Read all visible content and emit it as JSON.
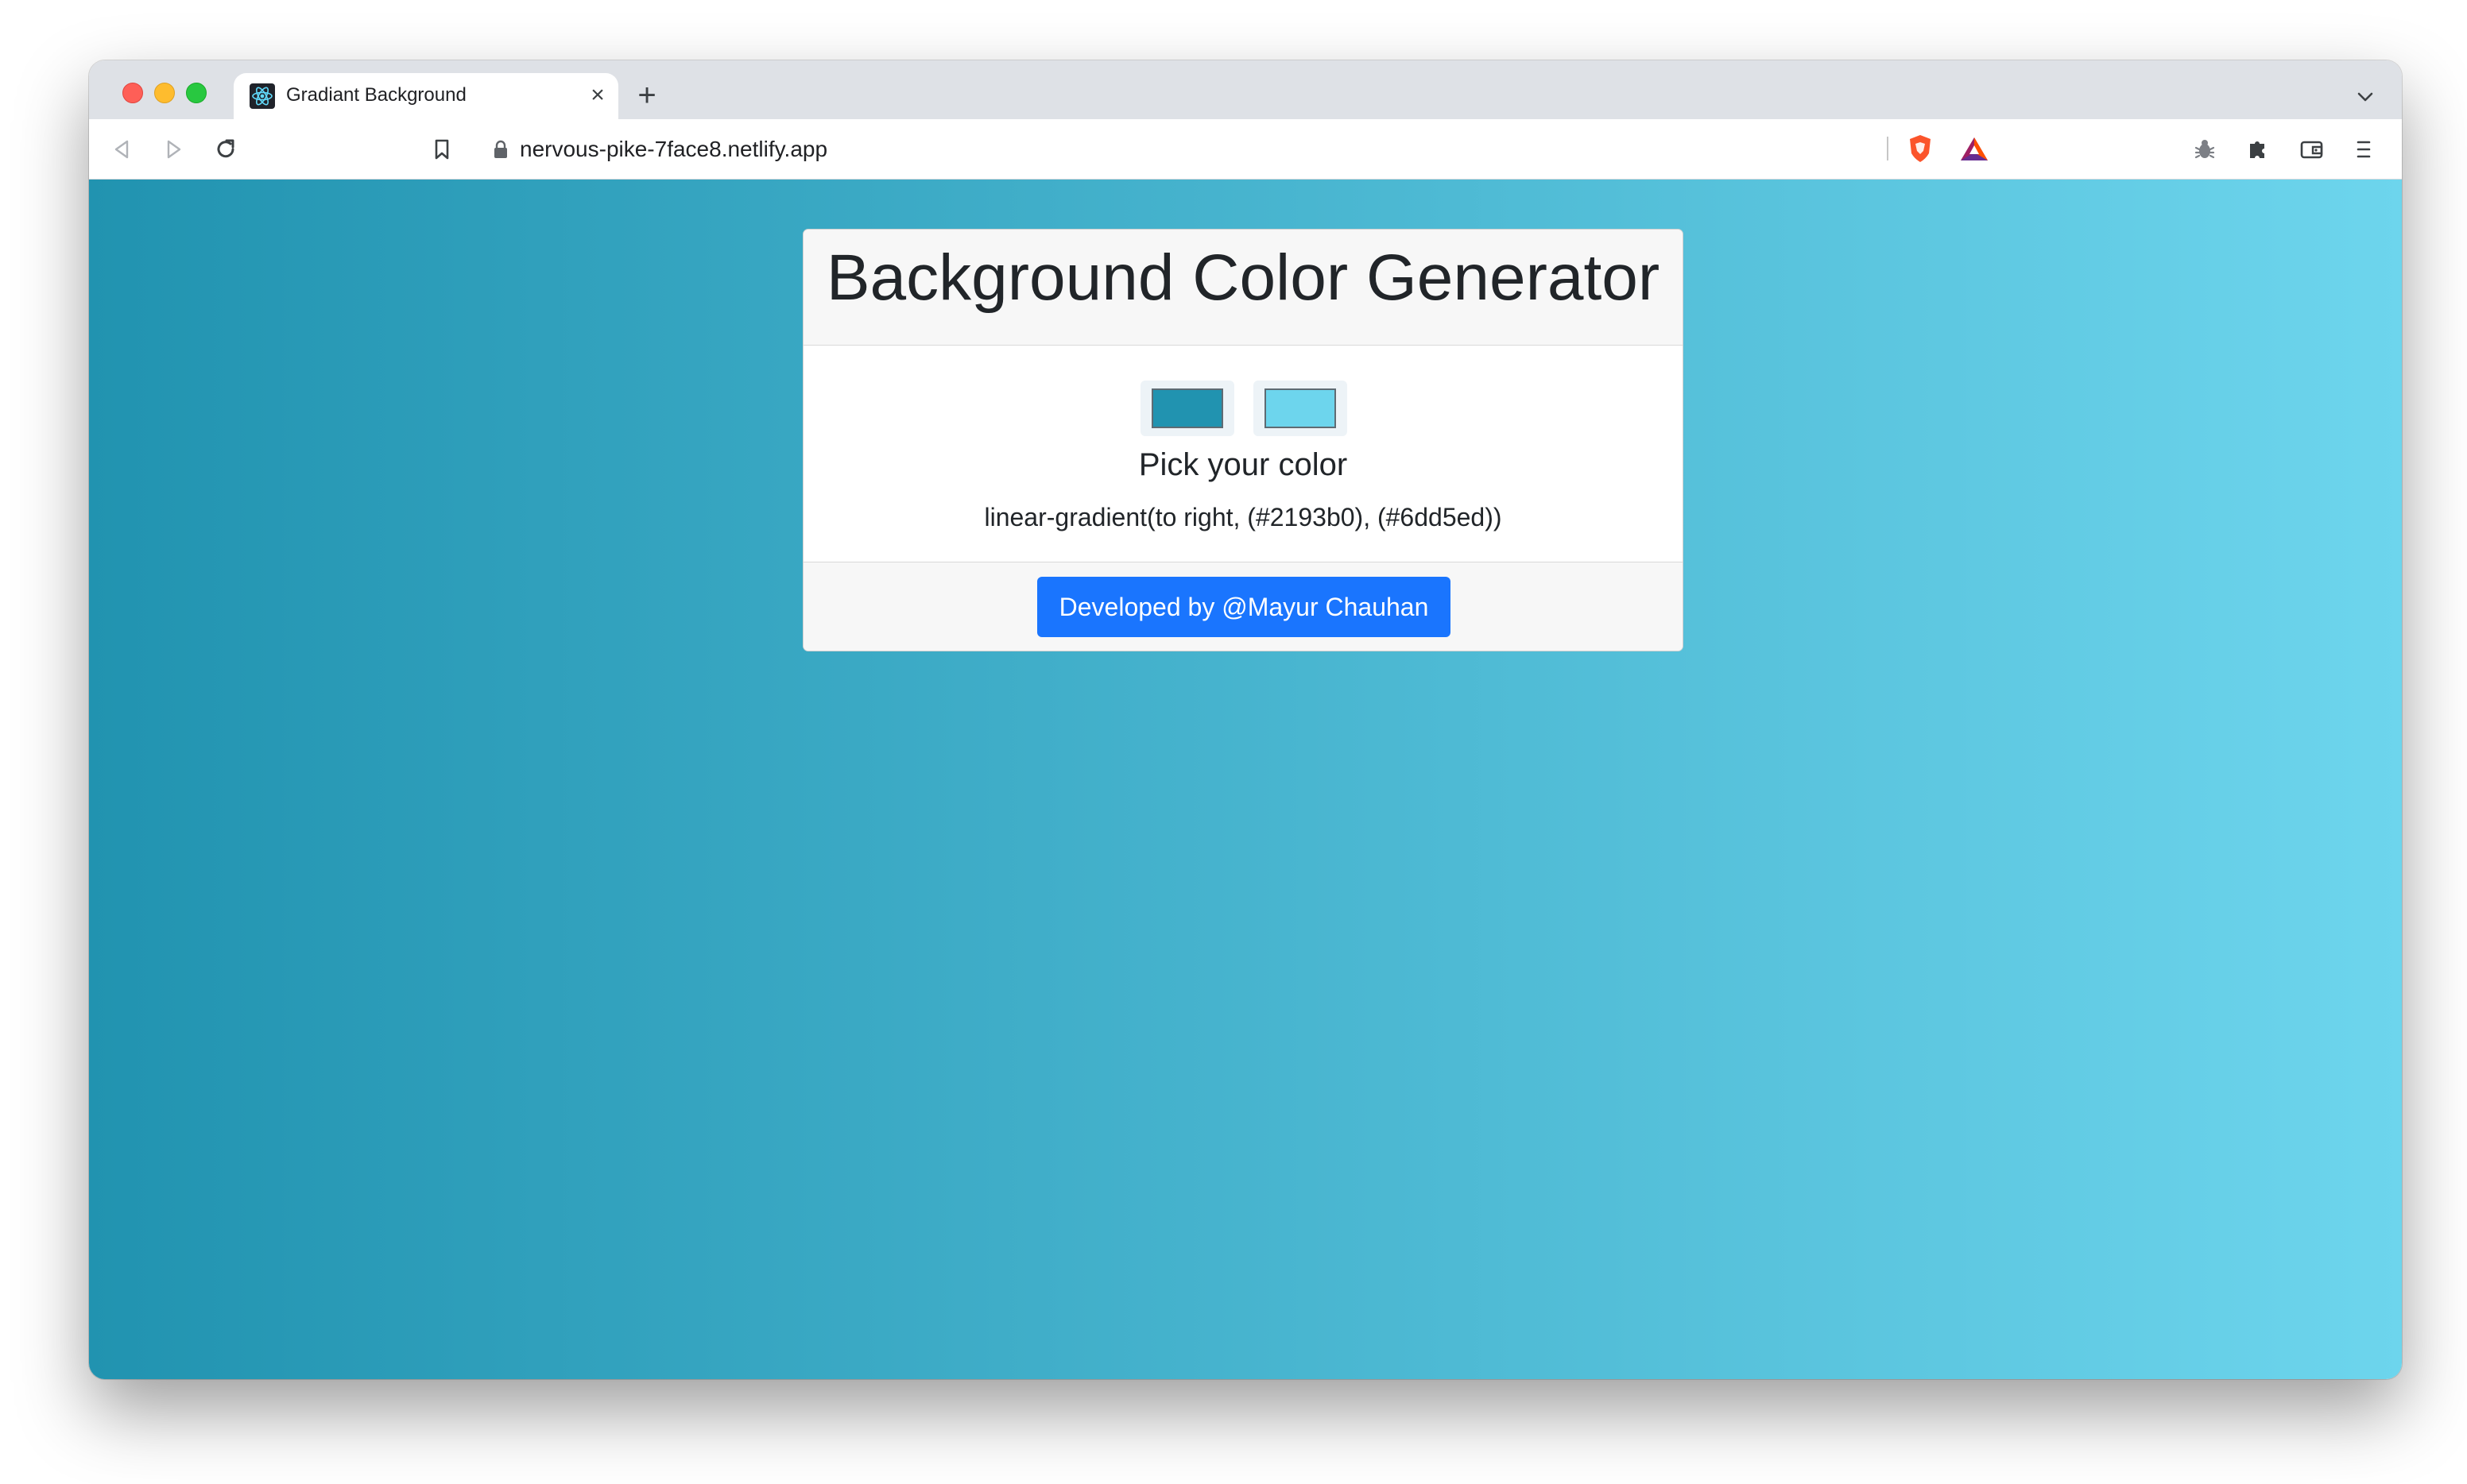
{
  "browser": {
    "tab": {
      "title": "Gradiant Background",
      "favicon_icon": "react-logo-icon",
      "close_glyph": "×"
    },
    "new_tab_glyph": "+",
    "toolbar": {
      "back_icon": "back-arrow-icon",
      "forward_icon": "forward-arrow-icon",
      "reload_icon": "reload-icon",
      "bookmark_icon": "bookmark-icon",
      "lock_icon": "lock-icon",
      "url": "nervous-pike-7face8.netlify.app",
      "shield_icon": "brave-shields-icon",
      "rewards_icon": "brave-rewards-icon",
      "bug_icon": "bug-icon",
      "extensions_icon": "puzzle-icon",
      "wallet_icon": "wallet-icon",
      "menu_icon": "menu-icon"
    }
  },
  "app": {
    "title": "Background Color Generator",
    "pick_label": "Pick your color",
    "gradient_css": "linear-gradient(to right, (#2193b0), (#6dd5ed))",
    "color1": "#2193b0",
    "color2": "#6dd5ed",
    "credit_button": "Developed by @Mayur Chauhan",
    "button_color": "#1a75fe"
  }
}
